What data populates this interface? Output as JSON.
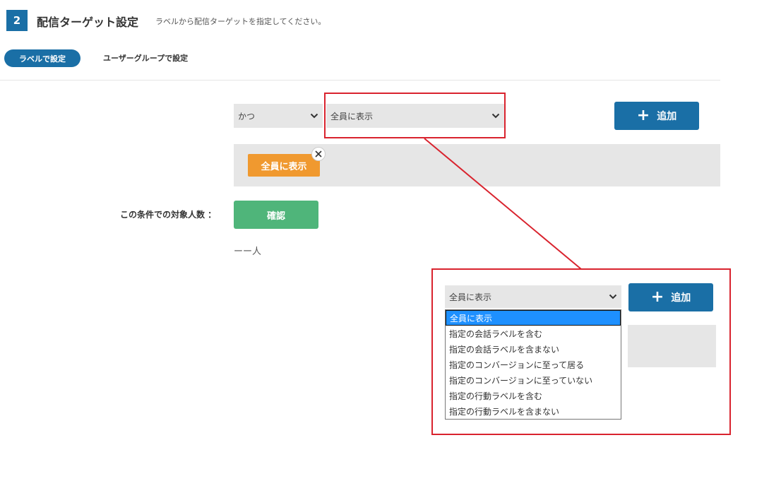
{
  "header": {
    "step_number": "2",
    "title": "配信ターゲット設定",
    "description": "ラベルから配信ターゲットを指定してください。"
  },
  "tabs": [
    {
      "label": "ラベルで設定",
      "active": true
    },
    {
      "label": "ユーザーグループで設定",
      "active": false
    }
  ],
  "condition": {
    "operator_value": "かつ",
    "label_value": "全員に表示",
    "add_button_label": "追加",
    "add_icon": "plus-icon"
  },
  "tags": [
    {
      "label": "全員に表示"
    }
  ],
  "target_count": {
    "label": "この条件での対象人数 ：",
    "confirm_label": "確認",
    "value": "ーー人"
  },
  "zoom": {
    "select_value": "全員に表示",
    "add_button_label": "追加",
    "options": [
      "全員に表示",
      "指定の会話ラベルを含む",
      "指定の会話ラベルを含まない",
      "指定のコンバージョンに至って居る",
      "指定のコンバージョンに至っていない",
      "指定の行動ラベルを含む",
      "指定の行動ラベルを含まない"
    ],
    "selected_index": 0
  },
  "colors": {
    "primary": "#1a6fa6",
    "tag": "#f0992f",
    "confirm": "#4fb57a",
    "highlight": "#d9232e",
    "selected_option": "#1e90ff"
  }
}
